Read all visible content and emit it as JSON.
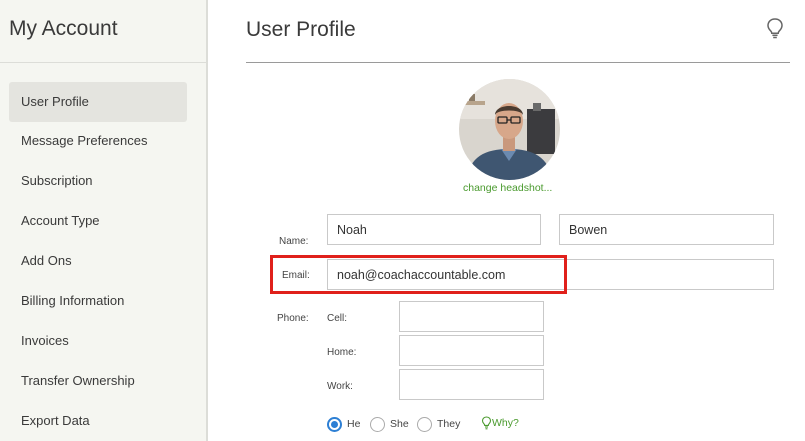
{
  "sidebar": {
    "title": "My Account",
    "items": [
      {
        "label": "User Profile"
      },
      {
        "label": "Message Preferences"
      },
      {
        "label": "Subscription"
      },
      {
        "label": "Account Type"
      },
      {
        "label": "Add Ons"
      },
      {
        "label": "Billing Information"
      },
      {
        "label": "Invoices"
      },
      {
        "label": "Transfer Ownership"
      },
      {
        "label": "Export Data"
      }
    ],
    "active_index": 0
  },
  "header": {
    "title": "User Profile",
    "help_icon": "lightbulb-icon"
  },
  "profile": {
    "change_headshot": "change headshot...",
    "name_label": "Name:",
    "first_name": "Noah",
    "last_name": "Bowen",
    "email_label": "Email:",
    "email": "noah@coachaccountable.com",
    "phone_label": "Phone:",
    "cell_label": "Cell:",
    "home_label": "Home:",
    "work_label": "Work:",
    "pronouns": [
      {
        "label": "He",
        "checked": true
      },
      {
        "label": "She",
        "checked": false
      },
      {
        "label": "They",
        "checked": false
      }
    ],
    "why_label": "Why?"
  },
  "colors": {
    "accent_green": "#4a9a2e",
    "highlight_red": "#e0201b",
    "radio_blue": "#2d7fd4"
  }
}
